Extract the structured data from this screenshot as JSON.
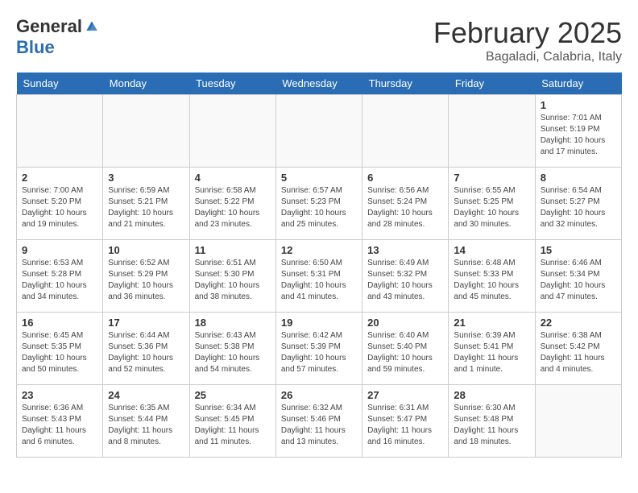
{
  "header": {
    "logo_general": "General",
    "logo_blue": "Blue",
    "month_title": "February 2025",
    "subtitle": "Bagaladi, Calabria, Italy"
  },
  "days_of_week": [
    "Sunday",
    "Monday",
    "Tuesday",
    "Wednesday",
    "Thursday",
    "Friday",
    "Saturday"
  ],
  "weeks": [
    [
      {
        "day": "",
        "info": ""
      },
      {
        "day": "",
        "info": ""
      },
      {
        "day": "",
        "info": ""
      },
      {
        "day": "",
        "info": ""
      },
      {
        "day": "",
        "info": ""
      },
      {
        "day": "",
        "info": ""
      },
      {
        "day": "1",
        "info": "Sunrise: 7:01 AM\nSunset: 5:19 PM\nDaylight: 10 hours\nand 17 minutes."
      }
    ],
    [
      {
        "day": "2",
        "info": "Sunrise: 7:00 AM\nSunset: 5:20 PM\nDaylight: 10 hours\nand 19 minutes."
      },
      {
        "day": "3",
        "info": "Sunrise: 6:59 AM\nSunset: 5:21 PM\nDaylight: 10 hours\nand 21 minutes."
      },
      {
        "day": "4",
        "info": "Sunrise: 6:58 AM\nSunset: 5:22 PM\nDaylight: 10 hours\nand 23 minutes."
      },
      {
        "day": "5",
        "info": "Sunrise: 6:57 AM\nSunset: 5:23 PM\nDaylight: 10 hours\nand 25 minutes."
      },
      {
        "day": "6",
        "info": "Sunrise: 6:56 AM\nSunset: 5:24 PM\nDaylight: 10 hours\nand 28 minutes."
      },
      {
        "day": "7",
        "info": "Sunrise: 6:55 AM\nSunset: 5:25 PM\nDaylight: 10 hours\nand 30 minutes."
      },
      {
        "day": "8",
        "info": "Sunrise: 6:54 AM\nSunset: 5:27 PM\nDaylight: 10 hours\nand 32 minutes."
      }
    ],
    [
      {
        "day": "9",
        "info": "Sunrise: 6:53 AM\nSunset: 5:28 PM\nDaylight: 10 hours\nand 34 minutes."
      },
      {
        "day": "10",
        "info": "Sunrise: 6:52 AM\nSunset: 5:29 PM\nDaylight: 10 hours\nand 36 minutes."
      },
      {
        "day": "11",
        "info": "Sunrise: 6:51 AM\nSunset: 5:30 PM\nDaylight: 10 hours\nand 38 minutes."
      },
      {
        "day": "12",
        "info": "Sunrise: 6:50 AM\nSunset: 5:31 PM\nDaylight: 10 hours\nand 41 minutes."
      },
      {
        "day": "13",
        "info": "Sunrise: 6:49 AM\nSunset: 5:32 PM\nDaylight: 10 hours\nand 43 minutes."
      },
      {
        "day": "14",
        "info": "Sunrise: 6:48 AM\nSunset: 5:33 PM\nDaylight: 10 hours\nand 45 minutes."
      },
      {
        "day": "15",
        "info": "Sunrise: 6:46 AM\nSunset: 5:34 PM\nDaylight: 10 hours\nand 47 minutes."
      }
    ],
    [
      {
        "day": "16",
        "info": "Sunrise: 6:45 AM\nSunset: 5:35 PM\nDaylight: 10 hours\nand 50 minutes."
      },
      {
        "day": "17",
        "info": "Sunrise: 6:44 AM\nSunset: 5:36 PM\nDaylight: 10 hours\nand 52 minutes."
      },
      {
        "day": "18",
        "info": "Sunrise: 6:43 AM\nSunset: 5:38 PM\nDaylight: 10 hours\nand 54 minutes."
      },
      {
        "day": "19",
        "info": "Sunrise: 6:42 AM\nSunset: 5:39 PM\nDaylight: 10 hours\nand 57 minutes."
      },
      {
        "day": "20",
        "info": "Sunrise: 6:40 AM\nSunset: 5:40 PM\nDaylight: 10 hours\nand 59 minutes."
      },
      {
        "day": "21",
        "info": "Sunrise: 6:39 AM\nSunset: 5:41 PM\nDaylight: 11 hours\nand 1 minute."
      },
      {
        "day": "22",
        "info": "Sunrise: 6:38 AM\nSunset: 5:42 PM\nDaylight: 11 hours\nand 4 minutes."
      }
    ],
    [
      {
        "day": "23",
        "info": "Sunrise: 6:36 AM\nSunset: 5:43 PM\nDaylight: 11 hours\nand 6 minutes."
      },
      {
        "day": "24",
        "info": "Sunrise: 6:35 AM\nSunset: 5:44 PM\nDaylight: 11 hours\nand 8 minutes."
      },
      {
        "day": "25",
        "info": "Sunrise: 6:34 AM\nSunset: 5:45 PM\nDaylight: 11 hours\nand 11 minutes."
      },
      {
        "day": "26",
        "info": "Sunrise: 6:32 AM\nSunset: 5:46 PM\nDaylight: 11 hours\nand 13 minutes."
      },
      {
        "day": "27",
        "info": "Sunrise: 6:31 AM\nSunset: 5:47 PM\nDaylight: 11 hours\nand 16 minutes."
      },
      {
        "day": "28",
        "info": "Sunrise: 6:30 AM\nSunset: 5:48 PM\nDaylight: 11 hours\nand 18 minutes."
      },
      {
        "day": "",
        "info": ""
      }
    ]
  ]
}
